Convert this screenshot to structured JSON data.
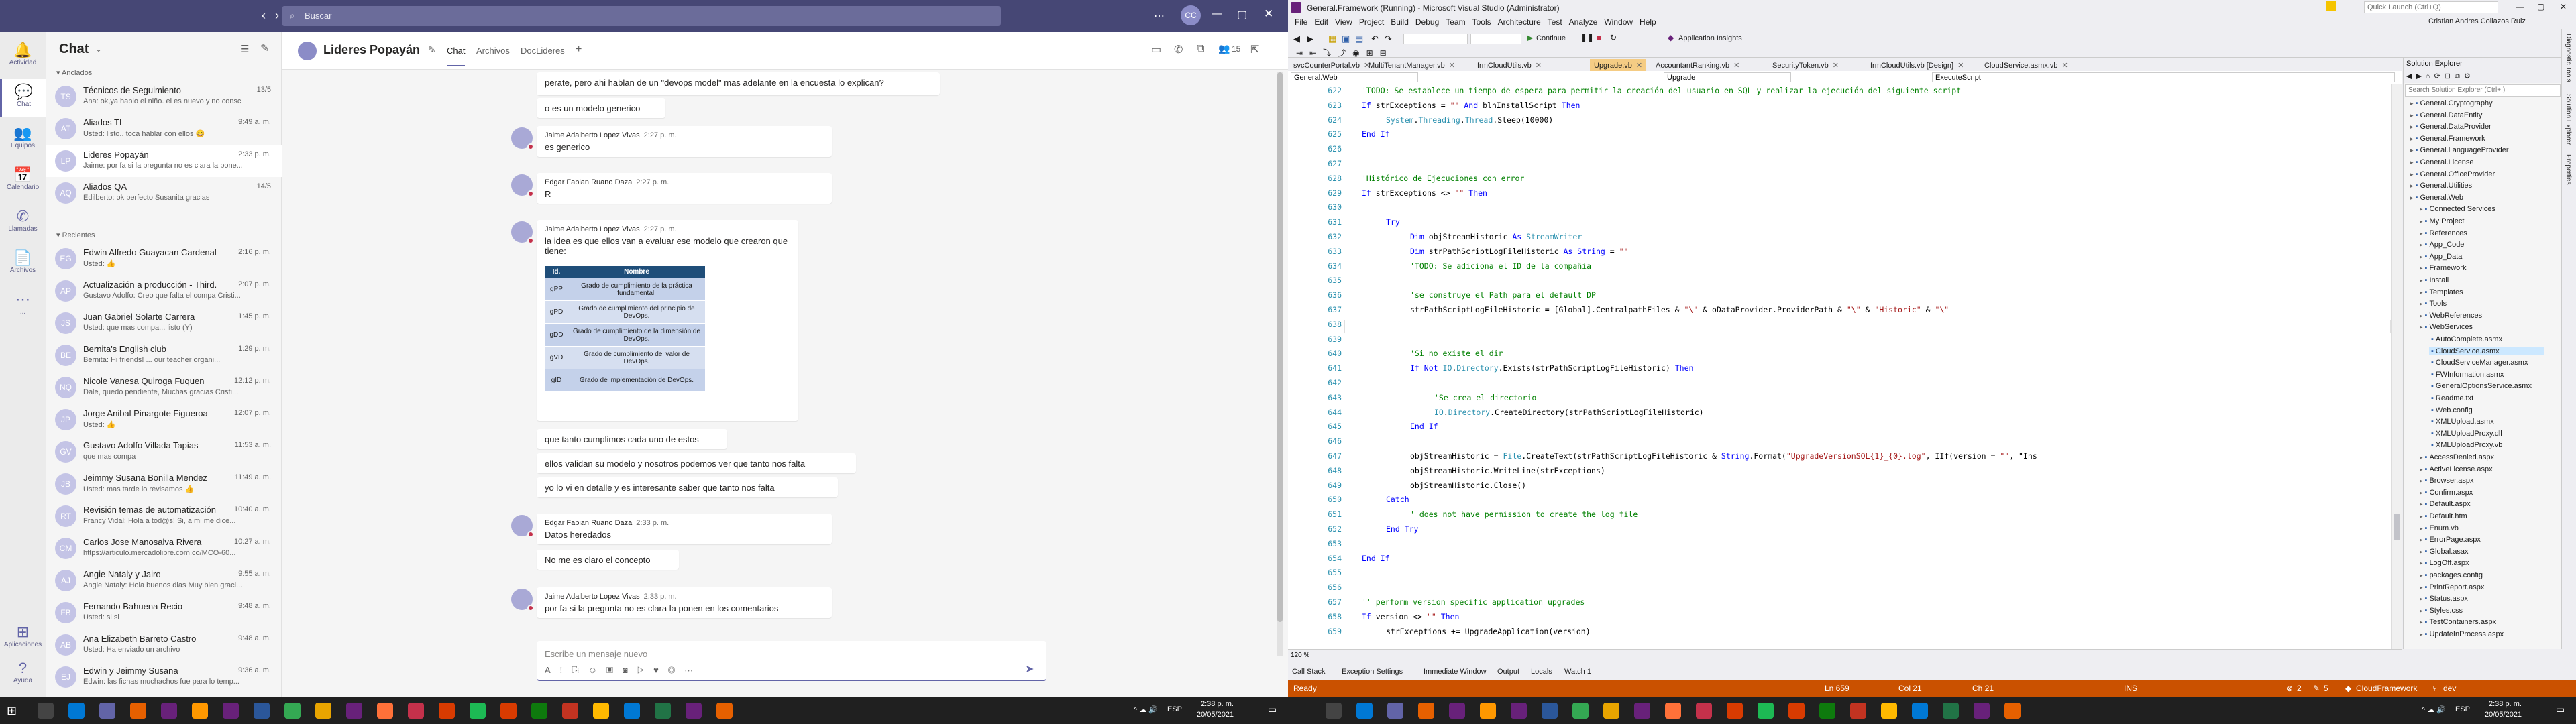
{
  "teams": {
    "search_placeholder": "Buscar",
    "rail": [
      {
        "label": "Actividad",
        "icon": "bell-icon"
      },
      {
        "label": "Chat",
        "icon": "chat-icon"
      },
      {
        "label": "Equipos",
        "icon": "teams-icon"
      },
      {
        "label": "Calendario",
        "icon": "calendar-icon"
      },
      {
        "label": "Llamadas",
        "icon": "phone-icon"
      },
      {
        "label": "Archivos",
        "icon": "file-icon"
      },
      {
        "label": "...",
        "icon": "more-icon"
      },
      {
        "label": "Aplicaciones",
        "icon": "apps-icon"
      },
      {
        "label": "Ayuda",
        "icon": "help-icon"
      }
    ],
    "list_title": "Chat",
    "pinned_label": "Anclados",
    "recent_label": "Recientes",
    "pinned": [
      {
        "name": "Técnicos de Seguimiento",
        "preview": "Ana: ok,ya hablo el niño. el es nuevo y no consci...",
        "time": "13/5",
        "initials": "TS"
      },
      {
        "name": "Aliados TL",
        "preview": "Usted: listo.. toca hablar con ellos 😄",
        "time": "9:49 a. m.",
        "initials": "AT"
      },
      {
        "name": "Lideres Popayán",
        "preview": "Jaime: por fa si la pregunta no es clara la pone...",
        "time": "2:33 p. m.",
        "initials": "LP"
      },
      {
        "name": "Aliados QA",
        "preview": "Edilberto: ok perfecto Susanita gracias",
        "time": "14/5",
        "initials": "AQ"
      }
    ],
    "recent": [
      {
        "name": "Edwin Alfredo Guayacan Cardenal",
        "preview": "Usted: 👍",
        "time": "2:16 p. m.",
        "initials": "EG"
      },
      {
        "name": "Actualización a producción - Third...",
        "preview": "Gustavo Adolfo: Creo que falta el compa Cristi...",
        "time": "2:07 p. m.",
        "initials": "AP"
      },
      {
        "name": "Juan Gabriel Solarte Carrera",
        "preview": "Usted: que mas compa... listo (Y)",
        "time": "1:45 p. m.",
        "initials": "JS"
      },
      {
        "name": "Bernita's English club",
        "preview": "Bernita: Hi friends! ... our teacher organi...",
        "time": "1:29 p. m.",
        "initials": "BE"
      },
      {
        "name": "Nicole Vanesa Quiroga Fuquen",
        "preview": "Dale, quedo pendiente, Muchas gracias Cristi...",
        "time": "12:12 p. m.",
        "initials": "NQ"
      },
      {
        "name": "Jorge Anibal Pinargote Figueroa",
        "preview": "Usted: 👍",
        "time": "12:07 p. m.",
        "initials": "JP"
      },
      {
        "name": "Gustavo Adolfo Villada Tapias",
        "preview": "que mas compa",
        "time": "11:53 a. m.",
        "initials": "GV"
      },
      {
        "name": "Jeimmy Susana Bonilla Mendez",
        "preview": "Usted: mas tarde lo revisamos 👍",
        "time": "11:49 a. m.",
        "initials": "JB"
      },
      {
        "name": "Revisión temas de automatización",
        "preview": "Francy Vidal: Hola a tod@s! Si, a mi me dice...",
        "time": "10:40 a. m.",
        "initials": "RT"
      },
      {
        "name": "Carlos Jose Manosalva Rivera",
        "preview": "https://articulo.mercadolibre.com.co/MCO-60...",
        "time": "10:27 a. m.",
        "initials": "CM"
      },
      {
        "name": "Angie Nataly y Jairo",
        "preview": "Angie Nataly: Hola buenos dias Muy bien graci...",
        "time": "9:55 a. m.",
        "initials": "AJ"
      },
      {
        "name": "Fernando Bahuena Recio",
        "preview": "Usted: si si",
        "time": "9:48 a. m.",
        "initials": "FB"
      },
      {
        "name": "Ana Elizabeth Barreto Castro",
        "preview": "Usted: Ha enviado un archivo",
        "time": "9:48 a. m.",
        "initials": "AB"
      },
      {
        "name": "Edwin y Jeimmy Susana",
        "preview": "Edwin: las fichas muchachos fue para lo temp...",
        "time": "9:36 a. m.",
        "initials": "EJ"
      }
    ],
    "header": {
      "chat_name": "Lideres Popayán",
      "tabs": [
        "Chat",
        "Archivos",
        "DocLideres"
      ],
      "participants": "15"
    },
    "messages": [
      {
        "kind": "text",
        "text": "perate, pero ahi hablan de un \"devops model\" mas adelante en la encuesta lo explican?"
      },
      {
        "kind": "text",
        "text": "o es un modelo generico"
      },
      {
        "kind": "full",
        "author": "Jaime Adalberto Lopez Vivas",
        "time": "2:27 p. m.",
        "text": "es generico"
      },
      {
        "kind": "full",
        "author": "Edgar Fabian Ruano Daza",
        "time": "2:27 p. m.",
        "text": "R"
      },
      {
        "kind": "full",
        "author": "Jaime Adalberto Lopez Vivas",
        "time": "2:27 p. m.",
        "text": "la idea es que ellos van a evaluar ese modelo que crearon que tiene:"
      },
      {
        "kind": "text",
        "text": "que tanto cumplimos cada uno de estos"
      },
      {
        "kind": "text",
        "text": "ellos validan su modelo y nosotros podemos ver que tanto nos falta"
      },
      {
        "kind": "text",
        "text": "yo lo vi en detalle y es interesante saber que tanto nos falta"
      },
      {
        "kind": "full",
        "author": "Edgar Fabian Ruano Daza",
        "time": "2:33 p. m.",
        "text": "Datos heredados"
      },
      {
        "kind": "text",
        "text": "No me es claro el concepto"
      },
      {
        "kind": "full",
        "author": "Jaime Adalberto Lopez Vivas",
        "time": "2:33 p. m.",
        "text": "por fa si la pregunta no es clara la ponen en los comentarios"
      }
    ],
    "table": {
      "headers": [
        "Id.",
        "Nombre"
      ],
      "rows": [
        [
          "gPP",
          "Grado de cumplimiento de la práctica fundamental."
        ],
        [
          "gPD",
          "Grado de cumplimiento del principio de DevOps."
        ],
        [
          "gDD",
          "Grado de cumplimiento de la dimensión de DevOps."
        ],
        [
          "gVD",
          "Grado de cumplimiento del valor de DevOps."
        ],
        [
          "gID",
          "Grado de implementación de DevOps."
        ]
      ]
    },
    "compose_placeholder": "Escribe un mensaje nuevo"
  },
  "vs": {
    "title": "General.Framework (Running) - Microsoft Visual Studio (Administrator)",
    "quick_launch": "Quick Launch (Ctrl+Q)",
    "user": "Cristian Andres Collazos Ruiz",
    "menu": [
      "File",
      "Edit",
      "View",
      "Project",
      "Build",
      "Debug",
      "Team",
      "Tools",
      "Architecture",
      "Test",
      "Analyze",
      "Window",
      "Help"
    ],
    "toolbar_continue": "Continue",
    "toolbar_insights": "Application Insights",
    "tabs": [
      "svcCounterPortal.vb",
      "MultiTenantManager.vb",
      "frmCloudUtils.vb",
      "Upgrade.vb",
      "AccountantRanking.vb",
      "SecurityToken.vb",
      "frmCloudUtils.vb [Design]",
      "CloudService.asmx.vb"
    ],
    "active_tab": "Upgrade.vb",
    "nav_left": "General.Web",
    "nav_mid": "Upgrade",
    "nav_right": "ExecuteScript",
    "zoom": "120 %",
    "code": [
      {
        "n": "622",
        "t": "'TODO: Se establece un tiempo de espera para permitir la creación del usuario en SQL y realizar la ejecución del siguiente script",
        "c": "cm",
        "i": 0
      },
      {
        "n": "623",
        "t": "If strExceptions = \"\" And blnInstallScript Then",
        "c": "",
        "i": 0
      },
      {
        "n": "624",
        "t": "System.Threading.Thread.Sleep(10000)",
        "c": "",
        "i": 1
      },
      {
        "n": "625",
        "t": "End If",
        "c": "kw",
        "i": 0
      },
      {
        "n": "626",
        "t": "",
        "c": "",
        "i": 0
      },
      {
        "n": "627",
        "t": "",
        "c": "",
        "i": 0
      },
      {
        "n": "628",
        "t": "'Histórico de Ejecuciones con error",
        "c": "cm",
        "i": 0
      },
      {
        "n": "629",
        "t": "If strExceptions <> \"\" Then",
        "c": "",
        "i": 0
      },
      {
        "n": "630",
        "t": "",
        "c": "",
        "i": 0
      },
      {
        "n": "631",
        "t": "Try",
        "c": "kw",
        "i": 1
      },
      {
        "n": "632",
        "t": "Dim objStreamHistoric As StreamWriter",
        "c": "",
        "i": 2
      },
      {
        "n": "633",
        "t": "Dim strPathScriptLogFileHistoric As String = \"\"",
        "c": "",
        "i": 2
      },
      {
        "n": "634",
        "t": "'TODO: Se adiciona el ID de la compañia",
        "c": "cm",
        "i": 2
      },
      {
        "n": "635",
        "t": "",
        "c": "",
        "i": 0
      },
      {
        "n": "636",
        "t": "'se construye el Path para el default DP",
        "c": "cm",
        "i": 2
      },
      {
        "n": "637",
        "t": "strPathScriptLogFileHistoric = [Global].CentralpathFiles & \"\\\" & oDataProvider.ProviderPath & \"\\\" & \"Historic\" & \"\\\"",
        "c": "",
        "i": 2
      },
      {
        "n": "638",
        "t": "",
        "c": "",
        "i": 0
      },
      {
        "n": "639",
        "t": "",
        "c": "",
        "i": 0
      },
      {
        "n": "640",
        "t": "'Si no existe el dir",
        "c": "cm",
        "i": 2
      },
      {
        "n": "641",
        "t": "If Not IO.Directory.Exists(strPathScriptLogFileHistoric) Then",
        "c": "",
        "i": 2
      },
      {
        "n": "642",
        "t": "",
        "c": "",
        "i": 0
      },
      {
        "n": "643",
        "t": "'Se crea el directorio",
        "c": "cm",
        "i": 3
      },
      {
        "n": "644",
        "t": "IO.Directory.CreateDirectory(strPathScriptLogFileHistoric)",
        "c": "",
        "i": 3
      },
      {
        "n": "645",
        "t": "End If",
        "c": "kw",
        "i": 2
      },
      {
        "n": "646",
        "t": "",
        "c": "",
        "i": 0
      },
      {
        "n": "647",
        "t": "objStreamHistoric = File.CreateText(strPathScriptLogFileHistoric & String.Format(\"UpgradeVersionSQL{1}_{0}.log\", IIf(version = \"\", \"Ins",
        "c": "",
        "i": 2
      },
      {
        "n": "648",
        "t": "objStreamHistoric.WriteLine(strExceptions)",
        "c": "",
        "i": 2
      },
      {
        "n": "649",
        "t": "objStreamHistoric.Close()",
        "c": "",
        "i": 2
      },
      {
        "n": "650",
        "t": "Catch",
        "c": "kw",
        "i": 1
      },
      {
        "n": "651",
        "t": "' does not have permission to create the log file",
        "c": "cm",
        "i": 2
      },
      {
        "n": "652",
        "t": "End Try",
        "c": "kw",
        "i": 1
      },
      {
        "n": "653",
        "t": "",
        "c": "",
        "i": 0
      },
      {
        "n": "654",
        "t": "End If",
        "c": "kw",
        "i": 0
      },
      {
        "n": "655",
        "t": "",
        "c": "",
        "i": 0
      },
      {
        "n": "656",
        "t": "",
        "c": "",
        "i": 0
      },
      {
        "n": "657",
        "t": "'' perform version specific application upgrades",
        "c": "cm",
        "i": 0
      },
      {
        "n": "658",
        "t": "If version <> \"\" Then",
        "c": "",
        "i": 0
      },
      {
        "n": "659",
        "t": "strExceptions += UpgradeApplication(version)",
        "c": "",
        "i": 1
      }
    ],
    "se_title": "Solution Explorer",
    "se_search": "Search Solution Explorer (Ctrl+;)",
    "se_items": [
      {
        "t": "General.Cryptography",
        "l": 0
      },
      {
        "t": "General.DataEntity",
        "l": 0
      },
      {
        "t": "General.DataProvider",
        "l": 0
      },
      {
        "t": "General.Framework",
        "l": 0
      },
      {
        "t": "General.LanguageProvider",
        "l": 0
      },
      {
        "t": "General.License",
        "l": 0
      },
      {
        "t": "General.OfficeProvider",
        "l": 0
      },
      {
        "t": "General.Utilities",
        "l": 0
      },
      {
        "t": "General.Web",
        "l": 0
      },
      {
        "t": "Connected Services",
        "l": 1
      },
      {
        "t": "My Project",
        "l": 1
      },
      {
        "t": "References",
        "l": 1
      },
      {
        "t": "App_Code",
        "l": 1
      },
      {
        "t": "App_Data",
        "l": 1
      },
      {
        "t": "Framework",
        "l": 1
      },
      {
        "t": "Install",
        "l": 1
      },
      {
        "t": "Templates",
        "l": 1
      },
      {
        "t": "Tools",
        "l": 1
      },
      {
        "t": "WebReferences",
        "l": 1
      },
      {
        "t": "WebServices",
        "l": 1
      },
      {
        "t": "AutoComplete.asmx",
        "l": 2
      },
      {
        "t": "CloudService.asmx",
        "l": 2
      },
      {
        "t": "CloudServiceManager.asmx",
        "l": 2
      },
      {
        "t": "FWInformation.asmx",
        "l": 2
      },
      {
        "t": "GeneralOptionsService.asmx",
        "l": 2
      },
      {
        "t": "Readme.txt",
        "l": 2
      },
      {
        "t": "Web.config",
        "l": 2
      },
      {
        "t": "XMLUpload.asmx",
        "l": 2
      },
      {
        "t": "XMLUploadProxy.dll",
        "l": 2
      },
      {
        "t": "XMLUploadProxy.vb",
        "l": 2
      },
      {
        "t": "AccessDenied.aspx",
        "l": 1
      },
      {
        "t": "ActiveLicense.aspx",
        "l": 1
      },
      {
        "t": "Browser.aspx",
        "l": 1
      },
      {
        "t": "Confirm.aspx",
        "l": 1
      },
      {
        "t": "Default.aspx",
        "l": 1
      },
      {
        "t": "Default.htm",
        "l": 1
      },
      {
        "t": "Enum.vb",
        "l": 1
      },
      {
        "t": "ErrorPage.aspx",
        "l": 1
      },
      {
        "t": "Global.asax",
        "l": 1
      },
      {
        "t": "LogOff.aspx",
        "l": 1
      },
      {
        "t": "packages.config",
        "l": 1
      },
      {
        "t": "PrintReport.aspx",
        "l": 1
      },
      {
        "t": "Status.aspx",
        "l": 1
      },
      {
        "t": "Styles.css",
        "l": 1
      },
      {
        "t": "TestContainers.aspx",
        "l": 1
      },
      {
        "t": "UpdateInProcess.aspx",
        "l": 1
      }
    ],
    "side_tabs": [
      "Diagnostic Tools",
      "Solution Explorer",
      "Properties"
    ],
    "bottom_tabs": [
      "Call Stack",
      "Exception Settings",
      "Immediate Window",
      "Output",
      "Locals",
      "Watch 1"
    ],
    "status": {
      "ready": "Ready",
      "ln": "Ln 659",
      "col": "Col 21",
      "ch": "Ch 21",
      "ins": "INS",
      "errors": "2",
      "warnings": "5",
      "project": "CloudFramework",
      "branch": "dev"
    }
  },
  "taskbar": {
    "time": "2:38 p. m.",
    "date": "20/05/2021",
    "lang": "ESP"
  }
}
